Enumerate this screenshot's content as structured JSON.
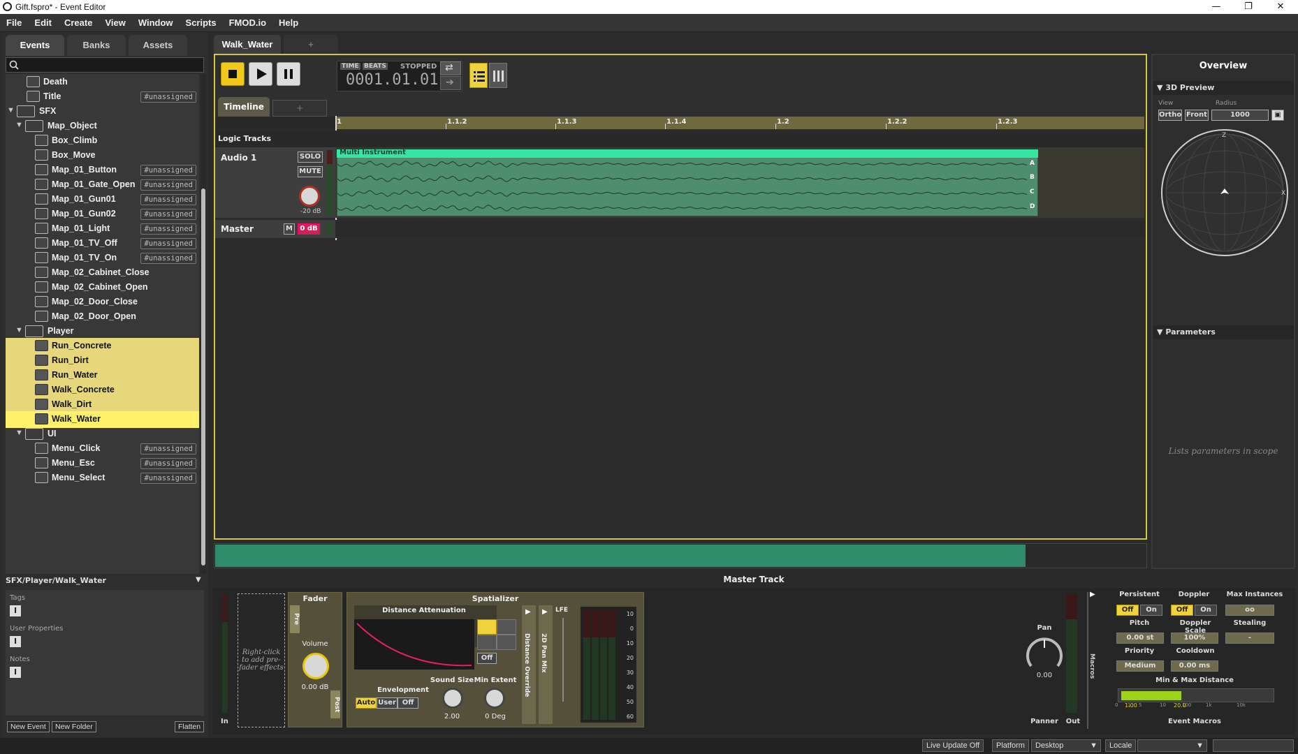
{
  "window": {
    "title": "Gift.fspro* - Event Editor",
    "minimize": "—",
    "maximize": "❐",
    "close": "✕"
  },
  "menu": [
    "File",
    "Edit",
    "Create",
    "View",
    "Window",
    "Scripts",
    "FMOD.io",
    "Help"
  ],
  "left_tabs": [
    "Events",
    "Banks",
    "Assets"
  ],
  "tree": [
    {
      "label": "Death",
      "indent": 2,
      "type": "event",
      "tag": ""
    },
    {
      "label": "Title",
      "indent": 2,
      "type": "event",
      "tag": "#unassigned"
    },
    {
      "label": "SFX",
      "indent": 0,
      "type": "folder",
      "tag": ""
    },
    {
      "label": "Map_Object",
      "indent": 1,
      "type": "folder",
      "tag": ""
    },
    {
      "label": "Box_Climb",
      "indent": 3,
      "type": "event",
      "tag": ""
    },
    {
      "label": "Box_Move",
      "indent": 3,
      "type": "event",
      "tag": ""
    },
    {
      "label": "Map_01_Button",
      "indent": 3,
      "type": "event",
      "tag": "#unassigned"
    },
    {
      "label": "Map_01_Gate_Open",
      "indent": 3,
      "type": "event",
      "tag": "#unassigned"
    },
    {
      "label": "Map_01_Gun01",
      "indent": 3,
      "type": "event",
      "tag": "#unassigned"
    },
    {
      "label": "Map_01_Gun02",
      "indent": 3,
      "type": "event",
      "tag": "#unassigned"
    },
    {
      "label": "Map_01_Light",
      "indent": 3,
      "type": "event",
      "tag": "#unassigned"
    },
    {
      "label": "Map_01_TV_Off",
      "indent": 3,
      "type": "event",
      "tag": "#unassigned"
    },
    {
      "label": "Map_01_TV_On",
      "indent": 3,
      "type": "event",
      "tag": "#unassigned"
    },
    {
      "label": "Map_02_Cabinet_Close",
      "indent": 3,
      "type": "event",
      "tag": ""
    },
    {
      "label": "Map_02_Cabinet_Open",
      "indent": 3,
      "type": "event",
      "tag": ""
    },
    {
      "label": "Map_02_Door_Close",
      "indent": 3,
      "type": "event",
      "tag": ""
    },
    {
      "label": "Map_02_Door_Open",
      "indent": 3,
      "type": "event",
      "tag": ""
    },
    {
      "label": "Player",
      "indent": 1,
      "type": "folder",
      "tag": ""
    },
    {
      "label": "Run_Concrete",
      "indent": 3,
      "type": "event",
      "tag": "",
      "state": "sel"
    },
    {
      "label": "Run_Dirt",
      "indent": 3,
      "type": "event",
      "tag": "",
      "state": "sel"
    },
    {
      "label": "Run_Water",
      "indent": 3,
      "type": "event",
      "tag": "",
      "state": "sel"
    },
    {
      "label": "Walk_Concrete",
      "indent": 3,
      "type": "event",
      "tag": "",
      "state": "sel"
    },
    {
      "label": "Walk_Dirt",
      "indent": 3,
      "type": "event",
      "tag": "",
      "state": "sel"
    },
    {
      "label": "Walk_Water",
      "indent": 3,
      "type": "event",
      "tag": "",
      "state": "hl"
    },
    {
      "label": "UI",
      "indent": 1,
      "type": "folder",
      "tag": ""
    },
    {
      "label": "Menu_Click",
      "indent": 3,
      "type": "event",
      "tag": "#unassigned"
    },
    {
      "label": "Menu_Esc",
      "indent": 3,
      "type": "event",
      "tag": "#unassigned"
    },
    {
      "label": "Menu_Select",
      "indent": 3,
      "type": "event",
      "tag": "#unassigned"
    }
  ],
  "path": "SFX/Player/Walk_Water",
  "props": {
    "tags": "Tags",
    "user_properties": "User Properties",
    "notes": "Notes"
  },
  "left_buttons": {
    "new_event": "New Event",
    "new_folder": "New Folder",
    "flatten": "Flatten"
  },
  "event_tabs": {
    "active": "Walk_Water",
    "add": "+"
  },
  "transport": {
    "time": "TIME",
    "beats": "BEATS",
    "status": "STOPPED",
    "position": "0001.01.01"
  },
  "timeline_tabs": {
    "active": "Timeline",
    "add": "+"
  },
  "ruler": [
    "1",
    "1.1.2",
    "1.1.3",
    "1.1.4",
    "1.2",
    "1.2.2",
    "1.2.3"
  ],
  "tracks": {
    "logic": "Logic Tracks",
    "audio": "Audio 1",
    "solo": "SOLO",
    "mute": "MUTE",
    "audio_vol": "-20 dB",
    "master": "Master",
    "master_m": "M",
    "master_vol": "0 dB",
    "instrument": "Multi Instrument",
    "lanes": [
      "A",
      "B",
      "C",
      "D"
    ]
  },
  "overview": {
    "title": "Overview",
    "preview": "3D Preview",
    "view_lbl": "View",
    "radius_lbl": "Radius",
    "ortho": "Ortho",
    "front": "Front",
    "radius": "1000",
    "z": "Z",
    "x": "X",
    "params": "Parameters",
    "params_empty": "Lists parameters in scope"
  },
  "master_track": "Master Track",
  "deck": {
    "in": "In",
    "prefx": "Right-click to add pre-fader effects",
    "fader": "Fader",
    "pre": "Pre",
    "post": "Post",
    "volume": "Volume",
    "volume_val": "0.00 dB",
    "spatializer": "Spatializer",
    "dist_att": "Distance Attenuation",
    "off": "Off",
    "envelopment": "Envelopment",
    "auto": "Auto",
    "user": "User",
    "env_off": "Off",
    "sound_size": "Sound Size",
    "sound_size_val": "2.00",
    "min_extent": "Min Extent",
    "min_extent_val": "0 Deg",
    "dist_override": "Distance Override",
    "pan_mix": "2D Pan Mix",
    "lfe": "LFE",
    "meter_scale": [
      "10",
      "0",
      "10",
      "20",
      "30",
      "40",
      "50",
      "60"
    ],
    "pan": "Pan",
    "pan_val": "0.00",
    "panner": "Panner",
    "out": "Out",
    "macros": "Macros",
    "persistent": "Persistent",
    "p_off": "Off",
    "p_on": "On",
    "doppler": "Doppler",
    "d_off": "Off",
    "d_on": "On",
    "max_inst": "Max Instances",
    "max_inst_val": "oo",
    "pitch": "Pitch",
    "pitch_val": "0.00 st",
    "doppler_scale": "Doppler Scale",
    "doppler_scale_val": "100%",
    "stealing": "Stealing",
    "stealing_val": "-",
    "priority": "Priority",
    "priority_val": "Medium",
    "cooldown": "Cooldown",
    "cooldown_val": "0.00 ms",
    "minmax": "Min & Max Distance",
    "mm_min": "1.00",
    "mm_max": "20.0",
    "mm_scale": [
      "0",
      "1",
      "5",
      "10",
      "100",
      "1k",
      "10k"
    ],
    "event_macros": "Event Macros"
  },
  "status": {
    "live_update": "Live Update Off",
    "platform_lbl": "Platform",
    "platform": "Desktop",
    "locale_lbl": "Locale",
    "locale": ""
  },
  "colors": {
    "accent": "#d6c63a",
    "instrument": "#36e4a4",
    "selection": "#e6d87a"
  }
}
